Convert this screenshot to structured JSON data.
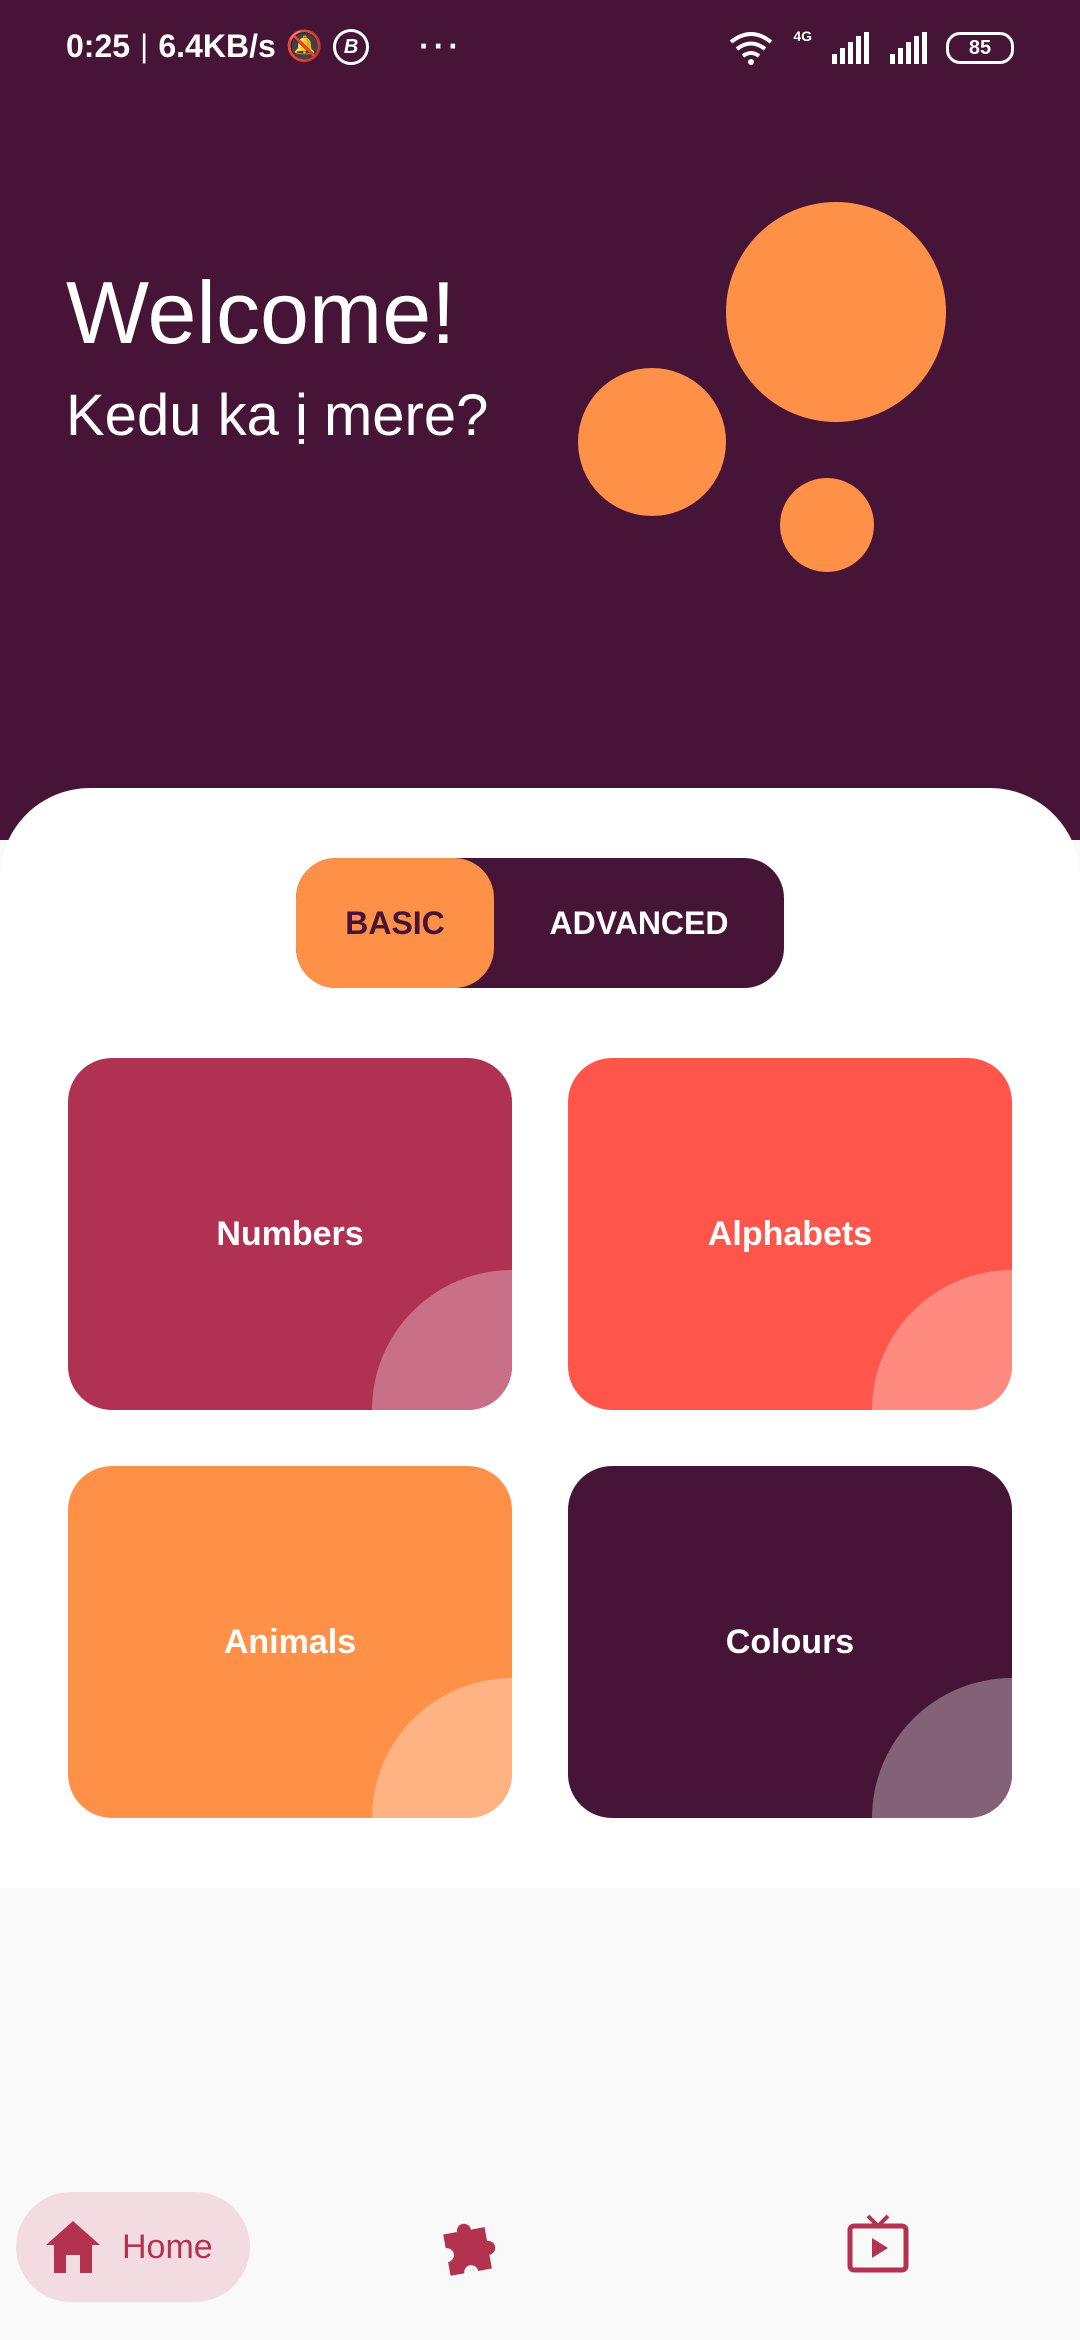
{
  "status_bar": {
    "time": "0:25",
    "speed": "6.4KB/s",
    "network": "4G",
    "battery": "85"
  },
  "header": {
    "welcome": "Welcome!",
    "greeting": "Kedu ka ị mere?"
  },
  "level_toggle": {
    "options": [
      "BASIC",
      "ADVANCED"
    ],
    "selected": "BASIC"
  },
  "categories": [
    {
      "label": "Numbers",
      "color": "#b03152",
      "accent": "#c97088"
    },
    {
      "label": "Alphabets",
      "color": "#ff554b",
      "accent": "#ff8a80"
    },
    {
      "label": "Animals",
      "color": "#fe9048",
      "accent": "#ffb282"
    },
    {
      "label": "Colours",
      "color": "#461436",
      "accent": "#836177"
    }
  ],
  "bottom_nav": {
    "items": [
      {
        "icon": "home-icon",
        "label": "Home",
        "active": true
      },
      {
        "icon": "puzzle-icon",
        "label": "",
        "active": false
      },
      {
        "icon": "tv-icon",
        "label": "",
        "active": false
      }
    ]
  }
}
